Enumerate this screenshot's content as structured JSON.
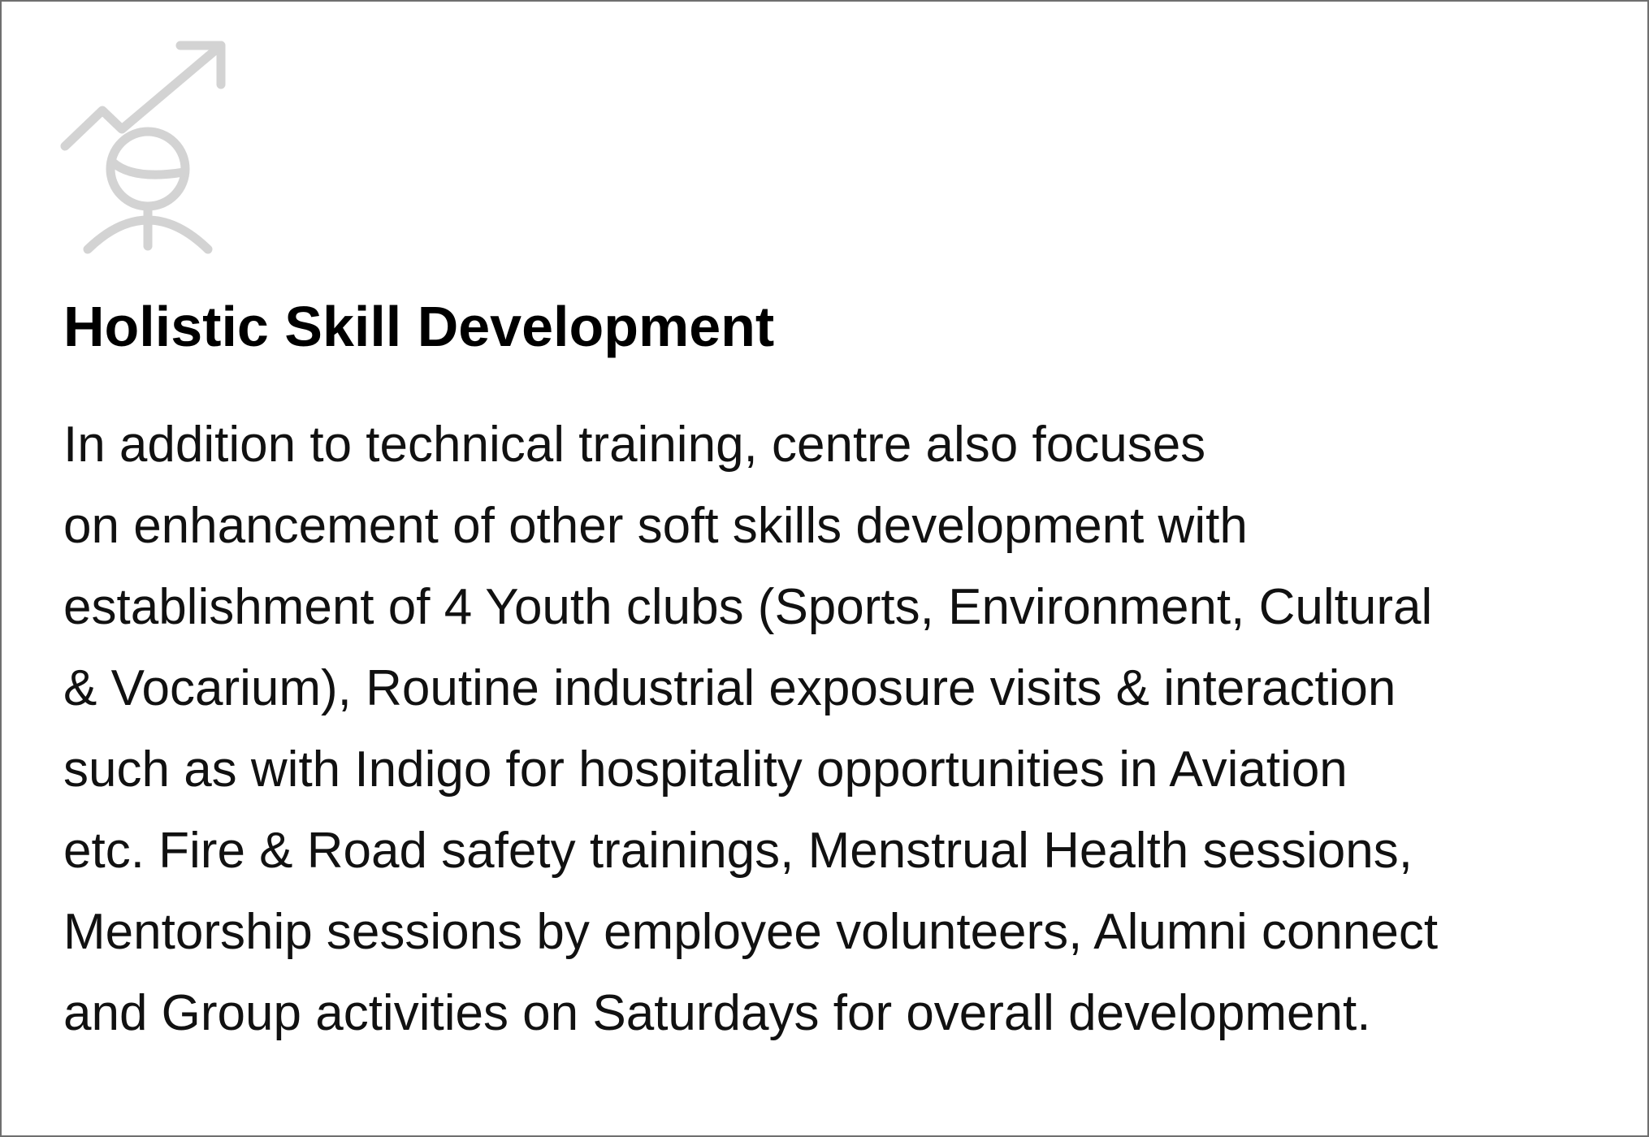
{
  "card": {
    "icon": "growth-person-icon",
    "icon_color": "#d3d3d3",
    "border_color": "#6f6f6f",
    "title": "Holistic Skill Development",
    "body_lines": [
      "In addition to technical training, centre also focuses",
      "on enhancement of other soft skills development with",
      "establishment of 4 Youth clubs (Sports, Environment, Cultural",
      "& Vocarium), Routine industrial exposure visits & interaction",
      "such as with Indigo for hospitality opportunities in Aviation",
      "etc. Fire & Road safety trainings, Menstrual Health sessions,",
      "Mentorship sessions by employee volunteers, Alumni connect",
      "and Group activities on Saturdays for overall development."
    ]
  }
}
